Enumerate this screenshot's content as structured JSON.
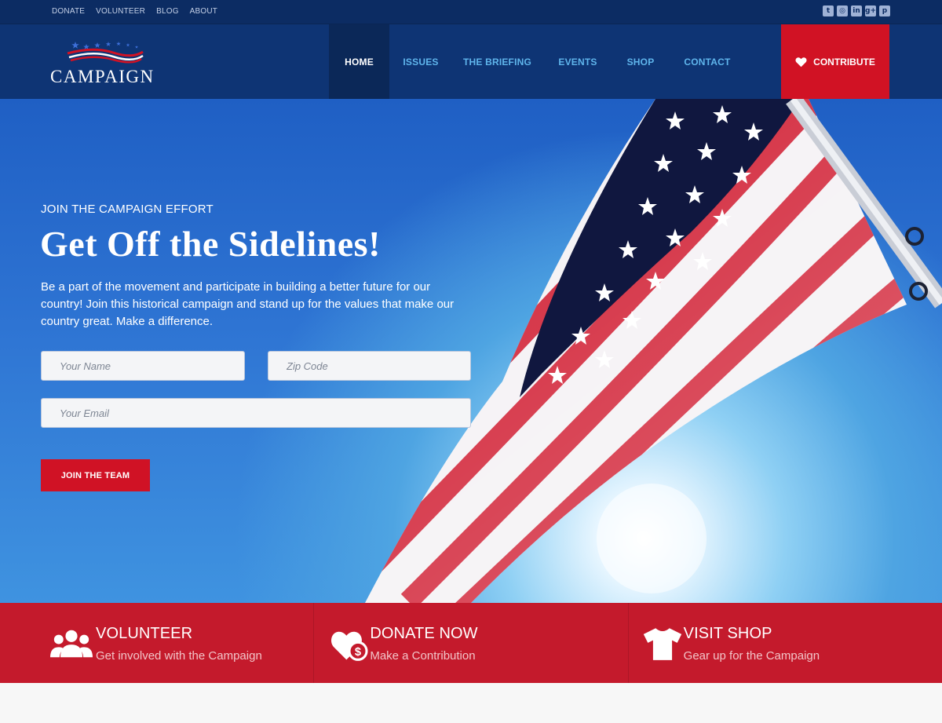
{
  "topbar": {
    "links": [
      "DONATE",
      "VOLUNTEER",
      "BLOG",
      "ABOUT"
    ],
    "social_icons": [
      "twitter-icon",
      "instagram-icon",
      "linkedin-icon",
      "google-plus-icon",
      "pinterest-icon"
    ]
  },
  "header": {
    "logo_text": "CAMPAIGN",
    "nav": [
      "HOME",
      "ISSUES",
      "THE BRIEFING",
      "EVENTS",
      "SHOP",
      "CONTACT"
    ],
    "active_nav": "HOME",
    "contribute_label": "CONTRIBUTE"
  },
  "hero": {
    "eyebrow": "JOIN THE CAMPAIGN EFFORT",
    "headline": "Get Off the Sidelines!",
    "lead": "Be a part of the movement and participate in building a better future for our country! Join this historical campaign and stand up for the values that make our country great. Make a difference.",
    "form": {
      "name_placeholder": "Your Name",
      "zip_placeholder": "Zip Code",
      "email_placeholder": "Your Email",
      "submit_label": "JOIN THE TEAM"
    }
  },
  "features": [
    {
      "title": "VOLUNTEER",
      "subtitle": "Get involved with the Campaign",
      "icon": "group-icon"
    },
    {
      "title": "DONATE NOW",
      "subtitle": "Make a Contribution",
      "icon": "heart-dollar-icon"
    },
    {
      "title": "VISIT SHOP",
      "subtitle": "Gear up for the Campaign",
      "icon": "t-shirt-icon"
    }
  ],
  "colors": {
    "topbar": "#0c2c63",
    "header": "#0e3474",
    "nav_link": "#5fb5ec",
    "accent_red": "#d11224",
    "band_red": "#c41a2c"
  }
}
